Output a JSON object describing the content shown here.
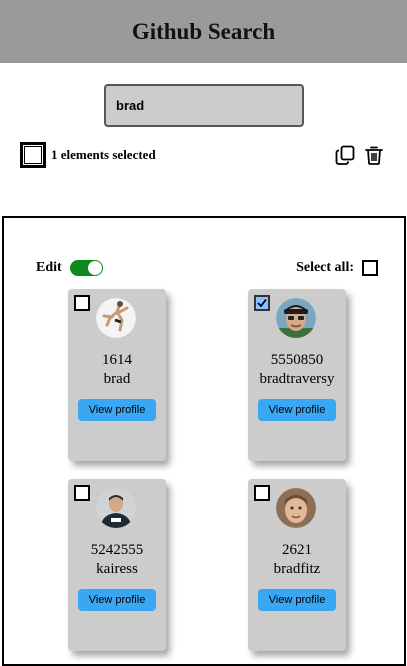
{
  "header": {
    "title": "Github Search"
  },
  "search": {
    "value": "brad"
  },
  "selection": {
    "text": "1 elements selected"
  },
  "toolbar": {
    "copy_icon": "copy-icon",
    "delete_icon": "trash-icon"
  },
  "controls": {
    "edit_label": "Edit",
    "edit_on": true,
    "select_all_label": "Select all:"
  },
  "colors": {
    "header_bg": "#9a9a9a",
    "card_bg": "#cccccc",
    "button_bg": "#3aa7f2",
    "toggle_on": "#0c8a1e",
    "checked_bg": "#88c3ff"
  },
  "cards": [
    {
      "score": "1614",
      "login": "brad",
      "button": "View profile",
      "checked": false
    },
    {
      "score": "5550850",
      "login": "bradtraversy",
      "button": "View profile",
      "checked": true
    },
    {
      "score": "5242555",
      "login": "kairess",
      "button": "View profile",
      "checked": false
    },
    {
      "score": "2621",
      "login": "bradfitz",
      "button": "View profile",
      "checked": false
    }
  ]
}
